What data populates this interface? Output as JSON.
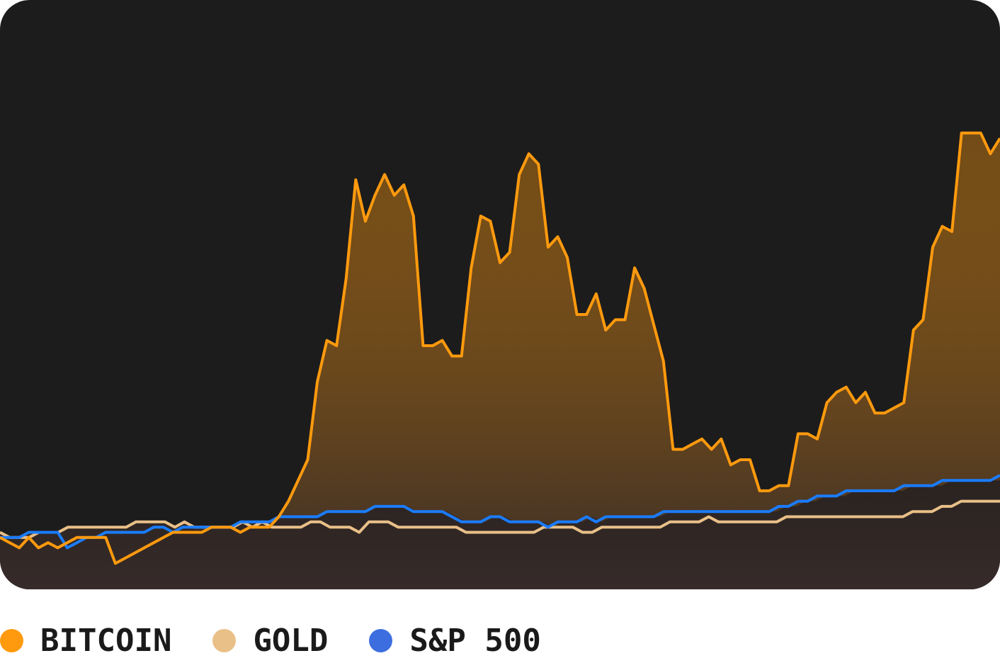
{
  "colors": {
    "background": "#1c1c1c",
    "bitcoin": "#ff9a0e",
    "gold": "#e9c088",
    "sp500": "#1a7cff",
    "legend_sp500_dot": "#3c6ee0"
  },
  "chart_data": {
    "type": "area",
    "title": "",
    "xlabel": "",
    "ylabel": "",
    "grid": false,
    "legend_position": "bottom-left",
    "ylim": [
      0,
      100
    ],
    "x_count": 100,
    "series": [
      {
        "name": "BITCOIN",
        "color": "#ff9a0e",
        "values": [
          10,
          9,
          8,
          10,
          8,
          9,
          8,
          9,
          10,
          10,
          10,
          10,
          5,
          6,
          7,
          8,
          9,
          10,
          11,
          11,
          11,
          11,
          12,
          12,
          12,
          11,
          12,
          12,
          12,
          14,
          17,
          21,
          25,
          40,
          48,
          47,
          60,
          79,
          71,
          76,
          80,
          76,
          78,
          72,
          47,
          47,
          48,
          45,
          45,
          62,
          72,
          71,
          63,
          65,
          80,
          84,
          82,
          66,
          68,
          64,
          53,
          53,
          57,
          50,
          52,
          52,
          62,
          58,
          51,
          44,
          27,
          27,
          28,
          29,
          27,
          29,
          24,
          25,
          25,
          19,
          19,
          20,
          20,
          30,
          30,
          29,
          36,
          38,
          39,
          36,
          38,
          34,
          34,
          35,
          36,
          50,
          52,
          66,
          70,
          69,
          88,
          88,
          88,
          84,
          87
        ]
      },
      {
        "name": "GOLD",
        "color": "#e9c088",
        "values": [
          11,
          10,
          10,
          10,
          11,
          11,
          11,
          12,
          12,
          12,
          12,
          12,
          12,
          12,
          13,
          13,
          13,
          13,
          12,
          13,
          12,
          12,
          12,
          12,
          12,
          13,
          12,
          13,
          12,
          12,
          12,
          12,
          13,
          13,
          12,
          12,
          12,
          11,
          13,
          13,
          13,
          12,
          12,
          12,
          12,
          12,
          12,
          12,
          11,
          11,
          11,
          11,
          11,
          11,
          11,
          11,
          12,
          12,
          12,
          12,
          11,
          11,
          12,
          12,
          12,
          12,
          12,
          12,
          12,
          13,
          13,
          13,
          13,
          14,
          13,
          13,
          13,
          13,
          13,
          13,
          13,
          14,
          14,
          14,
          14,
          14,
          14,
          14,
          14,
          14,
          14,
          14,
          14,
          14,
          15,
          15,
          15,
          16,
          16,
          17,
          17,
          17,
          17,
          17
        ]
      },
      {
        "name": "S&P 500",
        "color": "#1a7cff",
        "values": [
          10,
          10,
          10,
          11,
          11,
          11,
          11,
          8,
          9,
          10,
          10,
          11,
          11,
          11,
          11,
          11,
          12,
          12,
          11,
          12,
          12,
          12,
          12,
          12,
          12,
          13,
          13,
          13,
          13,
          14,
          14,
          14,
          14,
          14,
          15,
          15,
          15,
          15,
          15,
          16,
          16,
          16,
          16,
          15,
          15,
          15,
          15,
          14,
          13,
          13,
          13,
          14,
          14,
          13,
          13,
          13,
          13,
          12,
          13,
          13,
          13,
          14,
          13,
          14,
          14,
          14,
          14,
          14,
          14,
          15,
          15,
          15,
          15,
          15,
          15,
          15,
          15,
          15,
          15,
          15,
          15,
          16,
          16,
          17,
          17,
          18,
          18,
          18,
          19,
          19,
          19,
          19,
          19,
          19,
          20,
          20,
          20,
          20,
          21,
          21,
          21,
          21,
          21,
          21,
          22
        ]
      }
    ]
  },
  "legend": {
    "items": [
      {
        "label": "BITCOIN",
        "color": "#ff9a0e"
      },
      {
        "label": "GOLD",
        "color": "#e9c088"
      },
      {
        "label": "S&P 500",
        "color": "#3c6ee0"
      }
    ]
  }
}
